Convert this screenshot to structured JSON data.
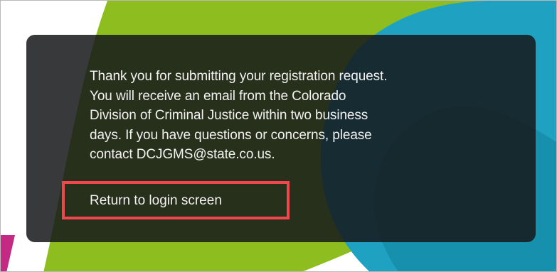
{
  "colors": {
    "page_background": "#ffffff",
    "panel_background": "#16181a",
    "panel_text": "#f2f2f2",
    "highlight_border": "#f0464c",
    "shape_lime": "#8ebd1f",
    "shape_teal": "#1fa2c2",
    "shape_magenta": "#c42a84"
  },
  "dialog": {
    "message_lines": [
      "Thank you for submitting your registration request.",
      "You will receive an email from the Colorado",
      "Division of Criminal Justice within two business",
      "days. If you have questions or concerns, please",
      "contact DCJGMS@state.co.us."
    ],
    "return_link_label": "Return to login screen"
  }
}
